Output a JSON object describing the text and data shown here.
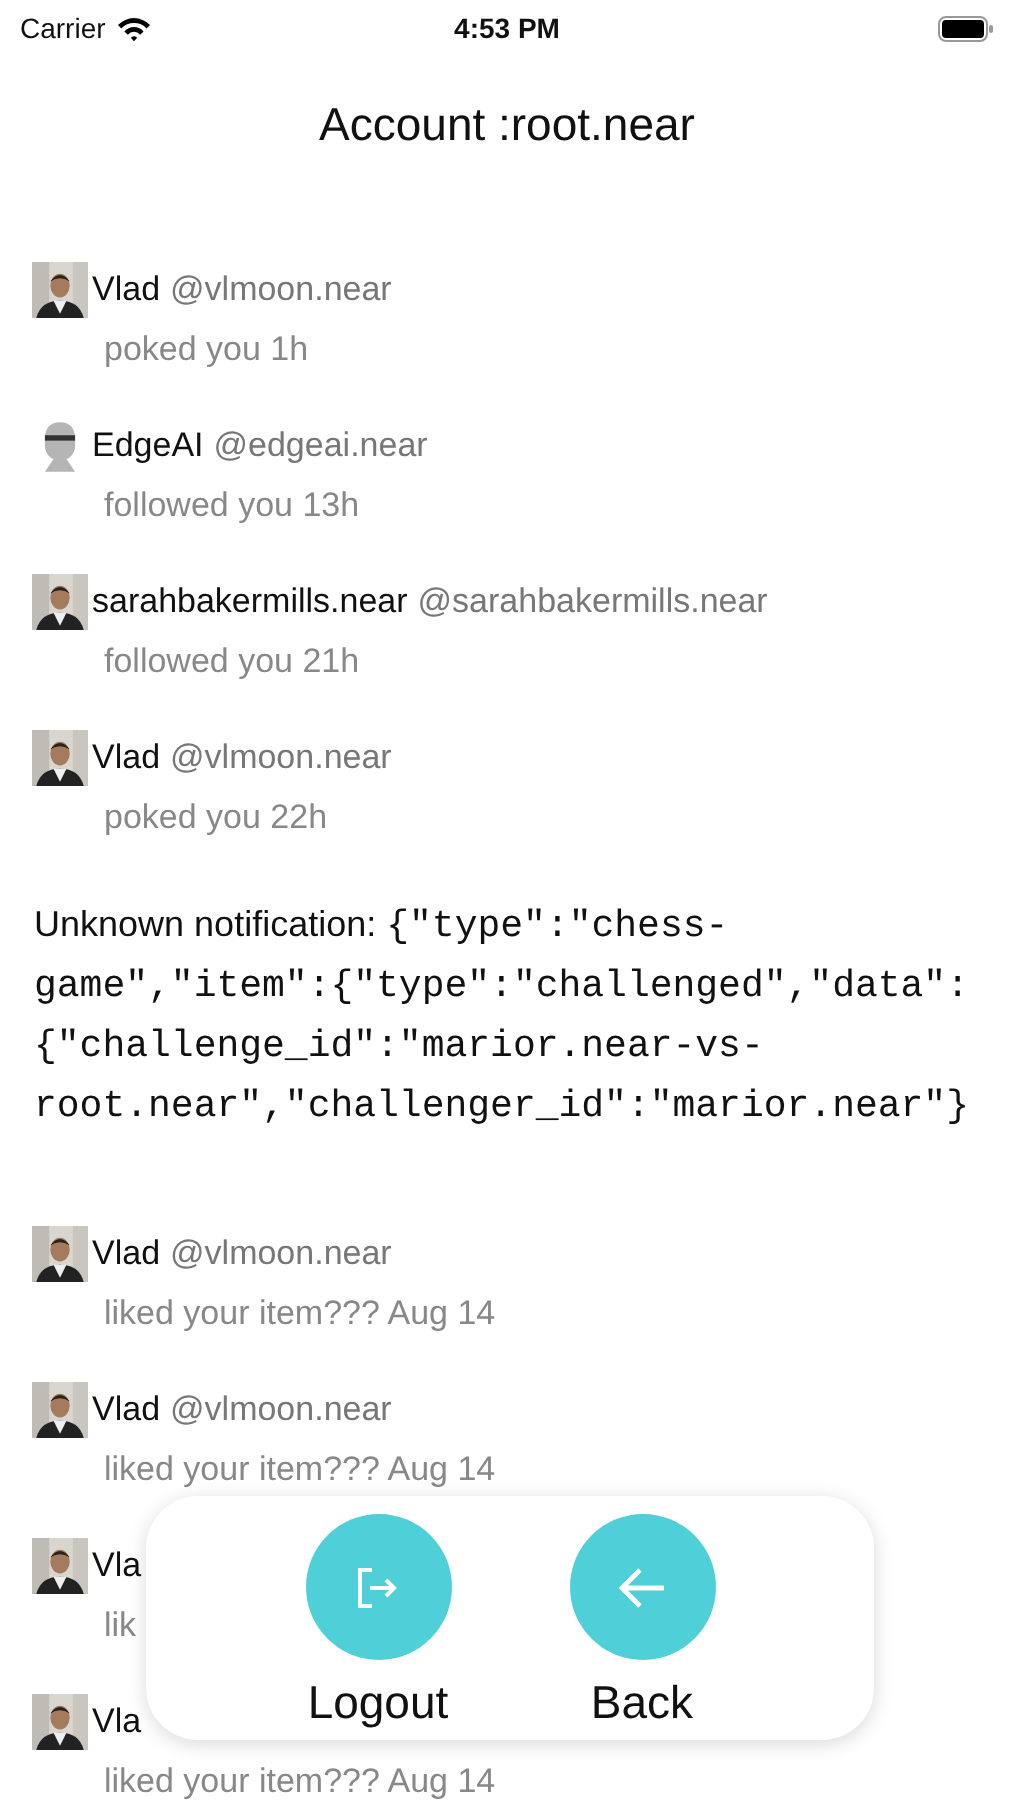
{
  "status_bar": {
    "carrier": "Carrier",
    "time": "4:53 PM"
  },
  "title": "Account :root.near",
  "notifications": [
    {
      "kind": "user",
      "name": "Vlad",
      "handle": "@vlmoon.near",
      "action": "poked you 1h"
    },
    {
      "kind": "user",
      "avatar": {
        "kind": "icon"
      },
      "name": "EdgeAI",
      "handle": "@edgeai.near",
      "action": "followed you 13h"
    },
    {
      "kind": "user",
      "name": "sarahbakermills.near",
      "handle": "@sarahbakermills.near",
      "action": "followed you 21h"
    },
    {
      "kind": "user",
      "name": "Vlad",
      "handle": "@vlmoon.near",
      "action": "poked you 22h"
    },
    {
      "kind": "unknown",
      "label": "Unknown notification:",
      "payload": "{\"type\":\"chess-game\",\"item\":{\"type\":\"challenged\",\"data\":{\"challenge_id\":\"marior.near-vs-root.near\",\"challenger_id\":\"marior.near\"}"
    },
    {
      "kind": "user",
      "name": "Vlad",
      "handle": "@vlmoon.near",
      "action": "liked your item??? Aug 14"
    },
    {
      "kind": "user",
      "name": "Vlad",
      "handle": "@vlmoon.near",
      "action": "liked your item??? Aug 14"
    },
    {
      "kind": "user",
      "name": "Vla",
      "action": "lik"
    },
    {
      "kind": "user",
      "name": "Vla",
      "action": "liked your item??? Aug 14"
    }
  ],
  "actions": [
    {
      "kind": "logout",
      "label": "Logout"
    },
    {
      "kind": "back",
      "label": "Back"
    }
  ]
}
